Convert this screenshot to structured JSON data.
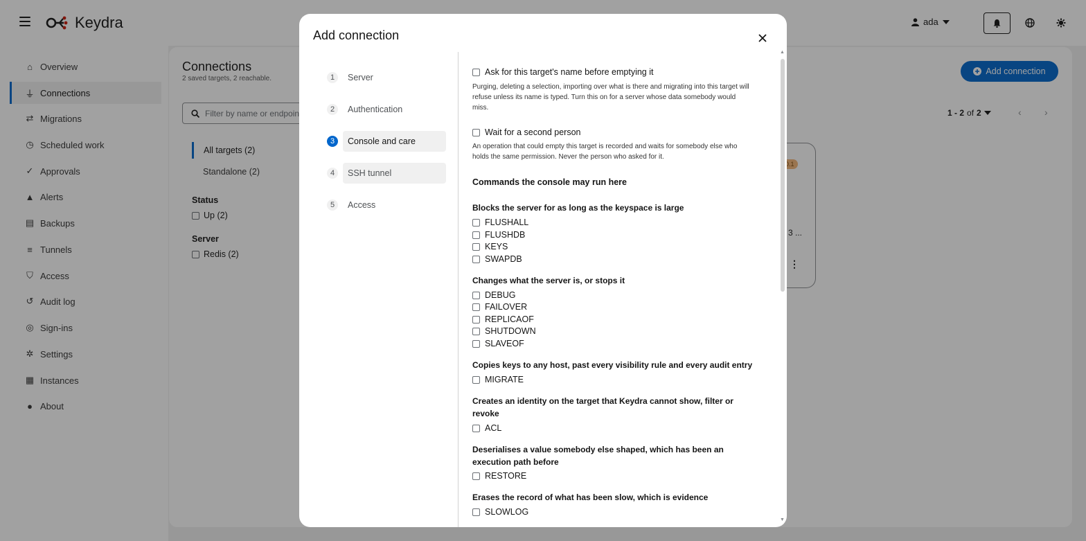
{
  "app": {
    "name": "Keydra",
    "user": "ada"
  },
  "sidebar": {
    "items": [
      {
        "label": "Overview",
        "icon": "home-icon"
      },
      {
        "label": "Connections",
        "icon": "plug-icon"
      },
      {
        "label": "Migrations",
        "icon": "arrows-icon"
      },
      {
        "label": "Scheduled work",
        "icon": "clock-icon"
      },
      {
        "label": "Approvals",
        "icon": "user-check-icon"
      },
      {
        "label": "Alerts",
        "icon": "bell-icon"
      },
      {
        "label": "Backups",
        "icon": "archive-icon"
      },
      {
        "label": "Tunnels",
        "icon": "network-icon"
      },
      {
        "label": "Access",
        "icon": "shield-icon"
      },
      {
        "label": "Audit log",
        "icon": "history-icon"
      },
      {
        "label": "Sign-ins",
        "icon": "fingerprint-icon"
      },
      {
        "label": "Settings",
        "icon": "gear-icon"
      },
      {
        "label": "Instances",
        "icon": "server-icon"
      },
      {
        "label": "About",
        "icon": "info-icon"
      }
    ],
    "active": "Connections"
  },
  "page": {
    "title": "Connections",
    "subtitle": "2 saved targets, 2 reachable.",
    "add_button": "Add connection",
    "filter_placeholder": "Filter by name or endpoint",
    "pager": {
      "range": "1 - 2",
      "of": "of",
      "total": "2"
    },
    "tabs": [
      "All targets (2)",
      "Standalone (2)"
    ],
    "facets": [
      {
        "heading": "Status",
        "options": [
          "Up (2)"
        ]
      },
      {
        "heading": "Server",
        "options": [
          "Redis (2)"
        ]
      }
    ],
    "card": {
      "badge": "0.1",
      "trunc": "3 ..."
    }
  },
  "modal": {
    "title": "Add connection",
    "steps": [
      {
        "num": "1",
        "label": "Server"
      },
      {
        "num": "2",
        "label": "Authentication"
      },
      {
        "num": "3",
        "label": "Console and care"
      },
      {
        "num": "4",
        "label": "SSH tunnel"
      },
      {
        "num": "5",
        "label": "Access"
      }
    ],
    "current_step": 3,
    "confirm_name": {
      "label": "Ask for this target's name before emptying it",
      "help": "Purging, deleting a selection, importing over what is there and migrating into this target will refuse unless its name is typed. Turn this on for a server whose data somebody would miss."
    },
    "second_person": {
      "label": "Wait for a second person",
      "help": "An operation that could empty this target is recorded and waits for somebody else who holds the same permission. Never the person who asked for it."
    },
    "commands_title": "Commands the console may run here",
    "groups": [
      {
        "title": "Blocks the server for as long as the keyspace is large",
        "commands": [
          "FLUSHALL",
          "FLUSHDB",
          "KEYS",
          "SWAPDB"
        ]
      },
      {
        "title": "Changes what the server is, or stops it",
        "commands": [
          "DEBUG",
          "FAILOVER",
          "REPLICAOF",
          "SHUTDOWN",
          "SLAVEOF"
        ]
      },
      {
        "title": "Copies keys to any host, past every visibility rule and every audit entry",
        "commands": [
          "MIGRATE"
        ]
      },
      {
        "title": "Creates an identity on the target that Keydra cannot show, filter or revoke",
        "commands": [
          "ACL"
        ]
      },
      {
        "title": "Deserialises a value somebody else shaped, which has been an execution path before",
        "commands": [
          "RESTORE"
        ]
      },
      {
        "title": "Erases the record of what has been slow, which is evidence",
        "commands": [
          "SLOWLOG"
        ]
      }
    ]
  },
  "colors": {
    "accent": "#0066cc",
    "overlay": "rgba(21,21,21,0.4)",
    "brand_red": "#c9190b"
  }
}
